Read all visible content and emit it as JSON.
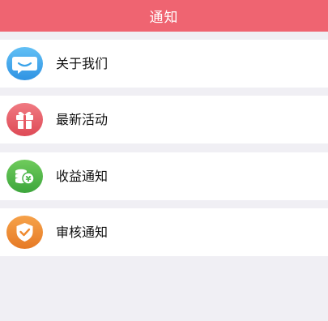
{
  "header": {
    "title": "通知"
  },
  "menu": {
    "items": [
      {
        "label": "关于我们",
        "icon": "smile-chat-icon",
        "color": "#3aa3ea"
      },
      {
        "label": "最新活动",
        "icon": "gift-icon",
        "color": "#e85a64"
      },
      {
        "label": "收益通知",
        "icon": "coins-yen-icon",
        "color": "#4bb54a"
      },
      {
        "label": "审核通知",
        "icon": "shield-check-icon",
        "color": "#ef8a30"
      }
    ]
  }
}
